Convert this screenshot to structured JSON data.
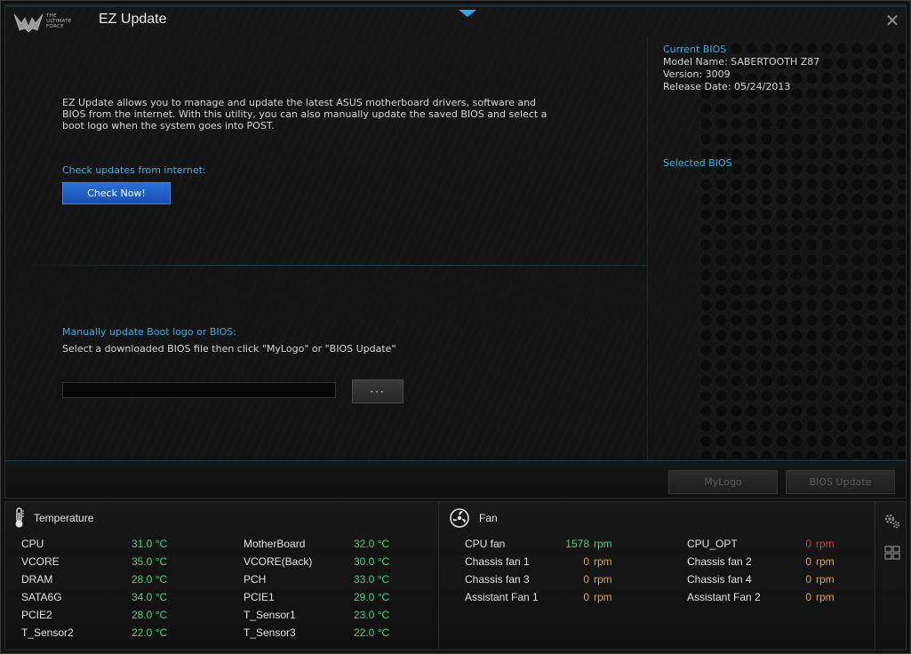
{
  "app": {
    "title": "EZ Update",
    "logo_text": "THE ULTIMATE FORCE",
    "close_symbol": "✕"
  },
  "main": {
    "description": "EZ Update allows you to manage and update the latest ASUS motherboard drivers, software and BIOS from the internet. With this utility, you can also manually update the saved BIOS and select a boot logo when the system goes into POST.",
    "check_label": "Check updates from internet:",
    "check_button": "Check Now!",
    "manual_label": "Manually update Boot logo or BIOS:",
    "manual_sub": "Select a downloaded BIOS file then click \"MyLogo\" or \"BIOS Update\"",
    "file_value": "",
    "browse_button": "···"
  },
  "bios": {
    "current_heading": "Current BIOS",
    "model_name": "Model Name: SABERTOOTH Z87",
    "version": "Version: 3009",
    "release_date": "Release Date: 05/24/2013",
    "selected_heading": "Selected BIOS"
  },
  "actions": {
    "mylogo": "MyLogo",
    "bios_update": "BIOS Update"
  },
  "temperature": {
    "title": "Temperature",
    "left": [
      {
        "label": "CPU",
        "value": "31.0 °C"
      },
      {
        "label": "VCORE",
        "value": "35.0 °C"
      },
      {
        "label": "DRAM",
        "value": "28.0 °C"
      },
      {
        "label": "SATA6G",
        "value": "34.0 °C"
      },
      {
        "label": "PCIE2",
        "value": "28.0 °C"
      },
      {
        "label": "T_Sensor2",
        "value": "22.0 °C"
      }
    ],
    "right": [
      {
        "label": "MotherBoard",
        "value": "32.0 °C"
      },
      {
        "label": "VCORE(Back)",
        "value": "30.0 °C"
      },
      {
        "label": "PCH",
        "value": "33.0 °C"
      },
      {
        "label": "PCIE1",
        "value": "29.0 °C"
      },
      {
        "label": "T_Sensor1",
        "value": "23.0 °C"
      },
      {
        "label": "T_Sensor3",
        "value": "22.0 °C"
      }
    ]
  },
  "fan": {
    "title": "Fan",
    "left": [
      {
        "label": "CPU fan",
        "value": "1578",
        "unit": "rpm",
        "status": "green"
      },
      {
        "label": "Chassis fan 1",
        "value": "0",
        "unit": "rpm",
        "status": "orange"
      },
      {
        "label": "Chassis fan 3",
        "value": "0",
        "unit": "rpm",
        "status": "orange"
      },
      {
        "label": "Assistant Fan 1",
        "value": "0",
        "unit": "rpm",
        "status": "orange"
      }
    ],
    "right": [
      {
        "label": "CPU_OPT",
        "value": "0",
        "unit": "rpm",
        "status": "red"
      },
      {
        "label": "Chassis fan 2",
        "value": "0",
        "unit": "rpm",
        "status": "orange"
      },
      {
        "label": "Chassis fan 4",
        "value": "0",
        "unit": "rpm",
        "status": "orange"
      },
      {
        "label": "Assistant Fan 2",
        "value": "0",
        "unit": "rpm",
        "status": "orange"
      }
    ]
  },
  "side": {
    "icons": [
      "gear-icon",
      "grid-view-icon"
    ]
  },
  "colors": {
    "accent_cyan": "#32b5e6",
    "ok_green": "#40d98a",
    "warn_orange": "#e8a82a",
    "alert_red": "#e83a2a",
    "button_blue": "#1f62c9"
  }
}
